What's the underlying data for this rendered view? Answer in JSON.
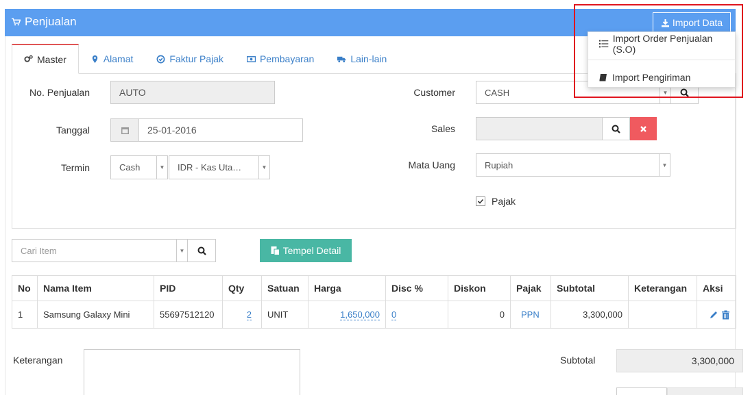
{
  "header": {
    "title": "Penjualan",
    "import_button": "Import Data"
  },
  "dropdown": {
    "items": [
      "Import Order Penjualan (S.O)",
      "Import Pengiriman"
    ]
  },
  "tabs": [
    {
      "label": "Master",
      "icon": "cogs-icon"
    },
    {
      "label": "Alamat",
      "icon": "map-marker-icon"
    },
    {
      "label": "Faktur Pajak",
      "icon": "check-circle-icon"
    },
    {
      "label": "Pembayaran",
      "icon": "money-icon"
    },
    {
      "label": "Lain-lain",
      "icon": "truck-icon"
    }
  ],
  "form": {
    "no_penjualan_label": "No. Penjualan",
    "no_penjualan_value": "AUTO",
    "tanggal_label": "Tanggal",
    "tanggal_value": "25-01-2016",
    "termin_label": "Termin",
    "termin_value": "Cash",
    "kas_value": "IDR - Kas Uta…",
    "customer_label": "Customer",
    "customer_value": "CASH",
    "sales_label": "Sales",
    "sales_value": "",
    "mata_uang_label": "Mata Uang",
    "mata_uang_value": "Rupiah",
    "pajak_label": "Pajak",
    "pajak_checked": true
  },
  "item_search": {
    "placeholder": "Cari Item",
    "paste_button": "Tempel Detail"
  },
  "table": {
    "headers": [
      "No",
      "Nama Item",
      "PID",
      "Qty",
      "Satuan",
      "Harga",
      "Disc %",
      "Diskon",
      "Pajak",
      "Subtotal",
      "Keterangan",
      "Aksi"
    ],
    "rows": [
      {
        "no": "1",
        "nama": "Samsung Galaxy Mini",
        "pid": "55697512120",
        "qty": "2",
        "satuan": "UNIT",
        "harga": "1,650,000",
        "disc": "0",
        "diskon": "0",
        "pajak": "PPN",
        "subtotal": "3,300,000",
        "keterangan": ""
      }
    ]
  },
  "footer": {
    "keterangan_label": "Keterangan",
    "subtotal_label": "Subtotal",
    "subtotal_value": "3,300,000"
  },
  "colors": {
    "header": "#5b9ef0",
    "teal": "#49b7a4",
    "danger": "#f05a5f",
    "highlight": "#e0141e",
    "link": "#3a7fc8"
  }
}
